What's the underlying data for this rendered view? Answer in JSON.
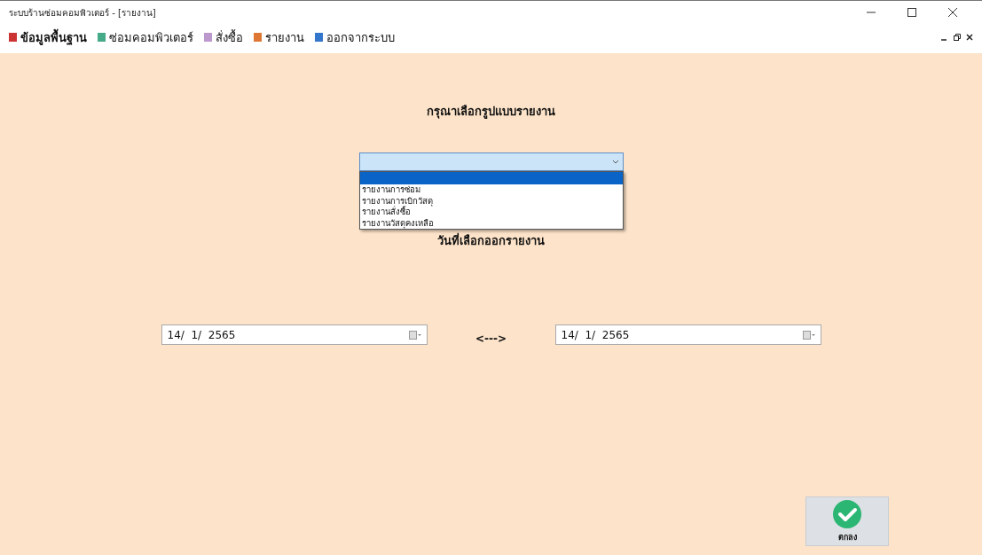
{
  "window": {
    "title": "ระบบร้านซ่อมคอมพิวเตอร์ - [รายงาน]"
  },
  "menu": [
    {
      "label": "ข้อมูลพื้นฐาน",
      "bold": true
    },
    {
      "label": "ซ่อมคอมพิวเตอร์",
      "bold": false
    },
    {
      "label": "สั่งซื้อ",
      "bold": false
    },
    {
      "label": "รายงาน",
      "bold": false
    },
    {
      "label": "ออกจากระบบ",
      "bold": false
    }
  ],
  "heading": "กรุณาเลือกรูปแบบรายงาน",
  "report_select": {
    "expanded": true,
    "blank_option_selected": true,
    "options": [
      {
        "label": "รายงานการซ่อม",
        "selected": false
      },
      {
        "label": "รายงานการเบิกวัสดุ",
        "selected": false
      },
      {
        "label": "รายงานสั่งซื้อ",
        "selected": false
      },
      {
        "label": "รายงานวัสดุคงเหลือ",
        "selected": false
      }
    ]
  },
  "date_heading": "วันที่เลือกออกรายงาน",
  "date_from": "14/  1/  2565",
  "range_arrow": "<--->",
  "date_to": "14/  1/  2565",
  "ok_button": "ตกลง"
}
